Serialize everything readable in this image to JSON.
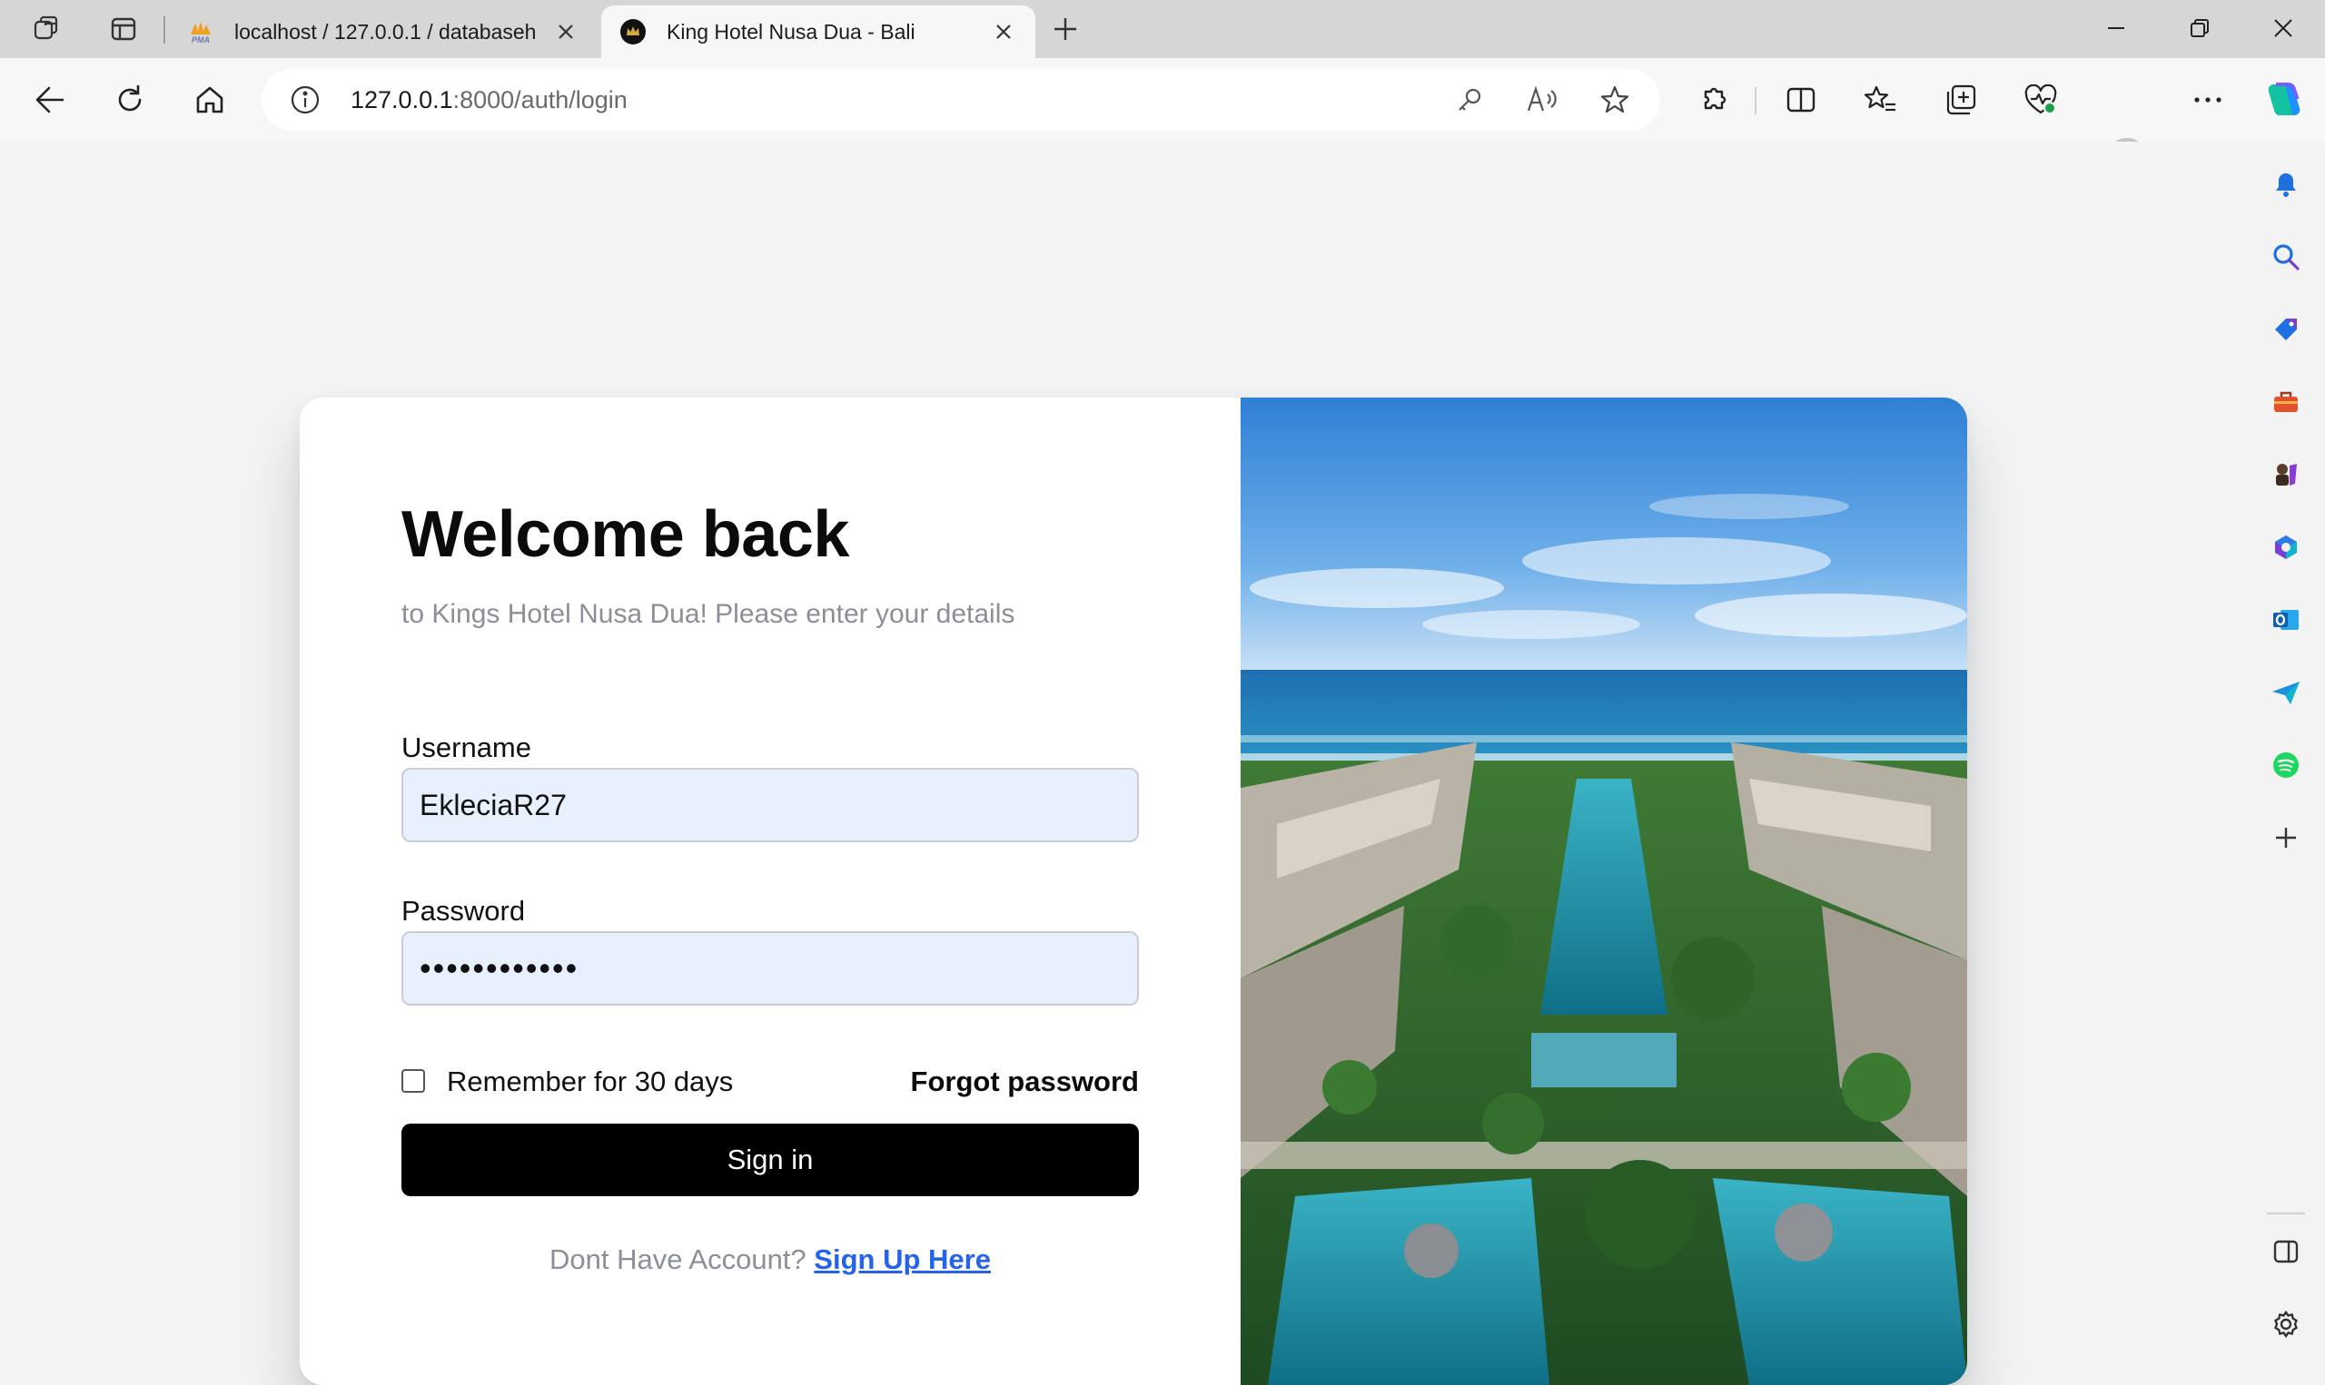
{
  "browser": {
    "tabs": [
      {
        "title": "localhost / 127.0.0.1 / databaseh",
        "active": false,
        "favicon": "phpmyadmin-icon",
        "favicon_text": "PMA"
      },
      {
        "title": "King Hotel Nusa Dua - Bali",
        "active": true,
        "favicon": "hotel-crown-icon"
      }
    ],
    "address": {
      "host": "127.0.0.1",
      "path": ":8000/auth/login"
    },
    "toolbar_icons": [
      "back-icon",
      "refresh-icon",
      "home-icon",
      "key-icon",
      "read-aloud-icon",
      "favorite-star-icon",
      "extensions-icon",
      "split-screen-icon",
      "favorites-icon",
      "collections-icon",
      "browser-essentials-icon",
      "profile-avatar",
      "more-icon",
      "copilot-icon"
    ],
    "sidebar_icons": [
      "bell-icon",
      "search-icon",
      "shopping-tag-icon",
      "toolbox-icon",
      "games-icon",
      "microsoft365-icon",
      "outlook-icon",
      "send-icon",
      "spotify-icon",
      "add-icon",
      "sidebar-layout-icon",
      "settings-gear-icon"
    ]
  },
  "login": {
    "title": "Welcome back",
    "subtitle": "to Kings Hotel Nusa Dua! Please enter your details",
    "username_label": "Username",
    "username_value": "EkleciaR27",
    "password_label": "Password",
    "password_value": "••••••••••••",
    "remember_label": "Remember for 30 days",
    "remember_checked": false,
    "forgot_label": "Forgot password",
    "signin_label": "Sign in",
    "no_account_text": "Dont Have Account?",
    "signup_link": "Sign Up Here"
  },
  "colors": {
    "accent_link": "#2563eb",
    "input_bg": "#e8f0fe",
    "button_bg": "#000000",
    "muted_text": "#8a8f98"
  }
}
